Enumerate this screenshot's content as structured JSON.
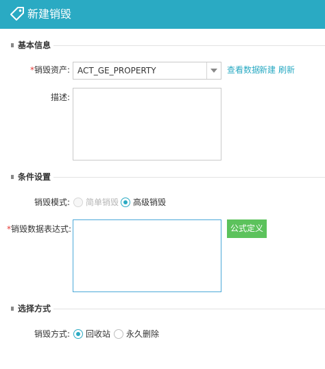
{
  "header": {
    "title": "新建销毁"
  },
  "sections": {
    "basic": "基本信息",
    "condition": "条件设置",
    "method": "选择方式"
  },
  "form": {
    "asset_label": "销毁资产:",
    "asset_value": "ACT_GE_PROPERTY",
    "links": {
      "view": "查看数据",
      "new": "新建",
      "refresh": "刷新"
    },
    "desc_label": "描述:",
    "mode_label": "销毁模式:",
    "mode_options": [
      "简单销毁",
      "高级销毁"
    ],
    "mode_selected": "高级销毁",
    "expr_label": "销毁数据表达式:",
    "formula_button": "公式定义",
    "method_label": "销毁方式:",
    "method_options": [
      "回收站",
      "永久删除"
    ],
    "method_selected": "回收站"
  },
  "colors": {
    "accent": "#2aaac3",
    "button_green": "#5cc25c",
    "required": "#e53935"
  }
}
